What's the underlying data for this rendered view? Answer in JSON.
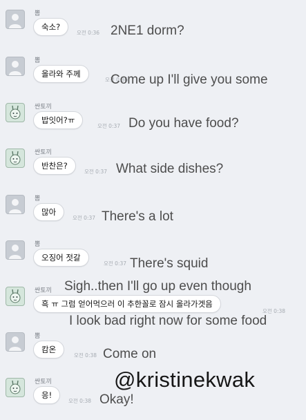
{
  "messages": [
    {
      "sender": "뽐",
      "text": "숙소?",
      "time": "오전 0:36",
      "translation": "2NE1 dorm?"
    },
    {
      "sender": "뽐",
      "text": "올라와 주께",
      "time": "오전 0:36",
      "translation": "Come up I'll give you some"
    },
    {
      "sender": "싼토끼",
      "text": "밥잇어?ㅠ",
      "time": "오전 0:37",
      "translation": "Do you have food?"
    },
    {
      "sender": "싼토끼",
      "text": "반찬은?",
      "time": "오전 0:37",
      "translation": "What side dishes?"
    },
    {
      "sender": "뽐",
      "text": "많아",
      "time": "오전 0:37",
      "translation": "There's a lot"
    },
    {
      "sender": "뽐",
      "text": "오징어 젓갈",
      "time": "오전 0:37",
      "translation": "There's squid"
    },
    {
      "sender": "싼토끼",
      "text": "흑 ㅠ 그럼 얻어먹으러 이 추한꼴로 잠시 올라가겟음",
      "time": "오전 0:38",
      "translation_line1": "Sigh..then I'll go up even though",
      "translation_line2": "I look bad right now for some food"
    },
    {
      "sender": "뽐",
      "text": "캄온",
      "time": "오전 0:38",
      "translation": "Come on"
    },
    {
      "sender": "싼토끼",
      "text": "응!",
      "time": "오전 0:38",
      "translation": "Okay!"
    }
  ],
  "watermark": "@kristinekwak",
  "colors": {
    "background": "#eef0f4",
    "bubble": "#ffffff",
    "translation_text": "#4d4d4d"
  },
  "icons": {
    "generic_avatar": "person-silhouette-icon",
    "character_avatar": "bunny-character-icon"
  }
}
